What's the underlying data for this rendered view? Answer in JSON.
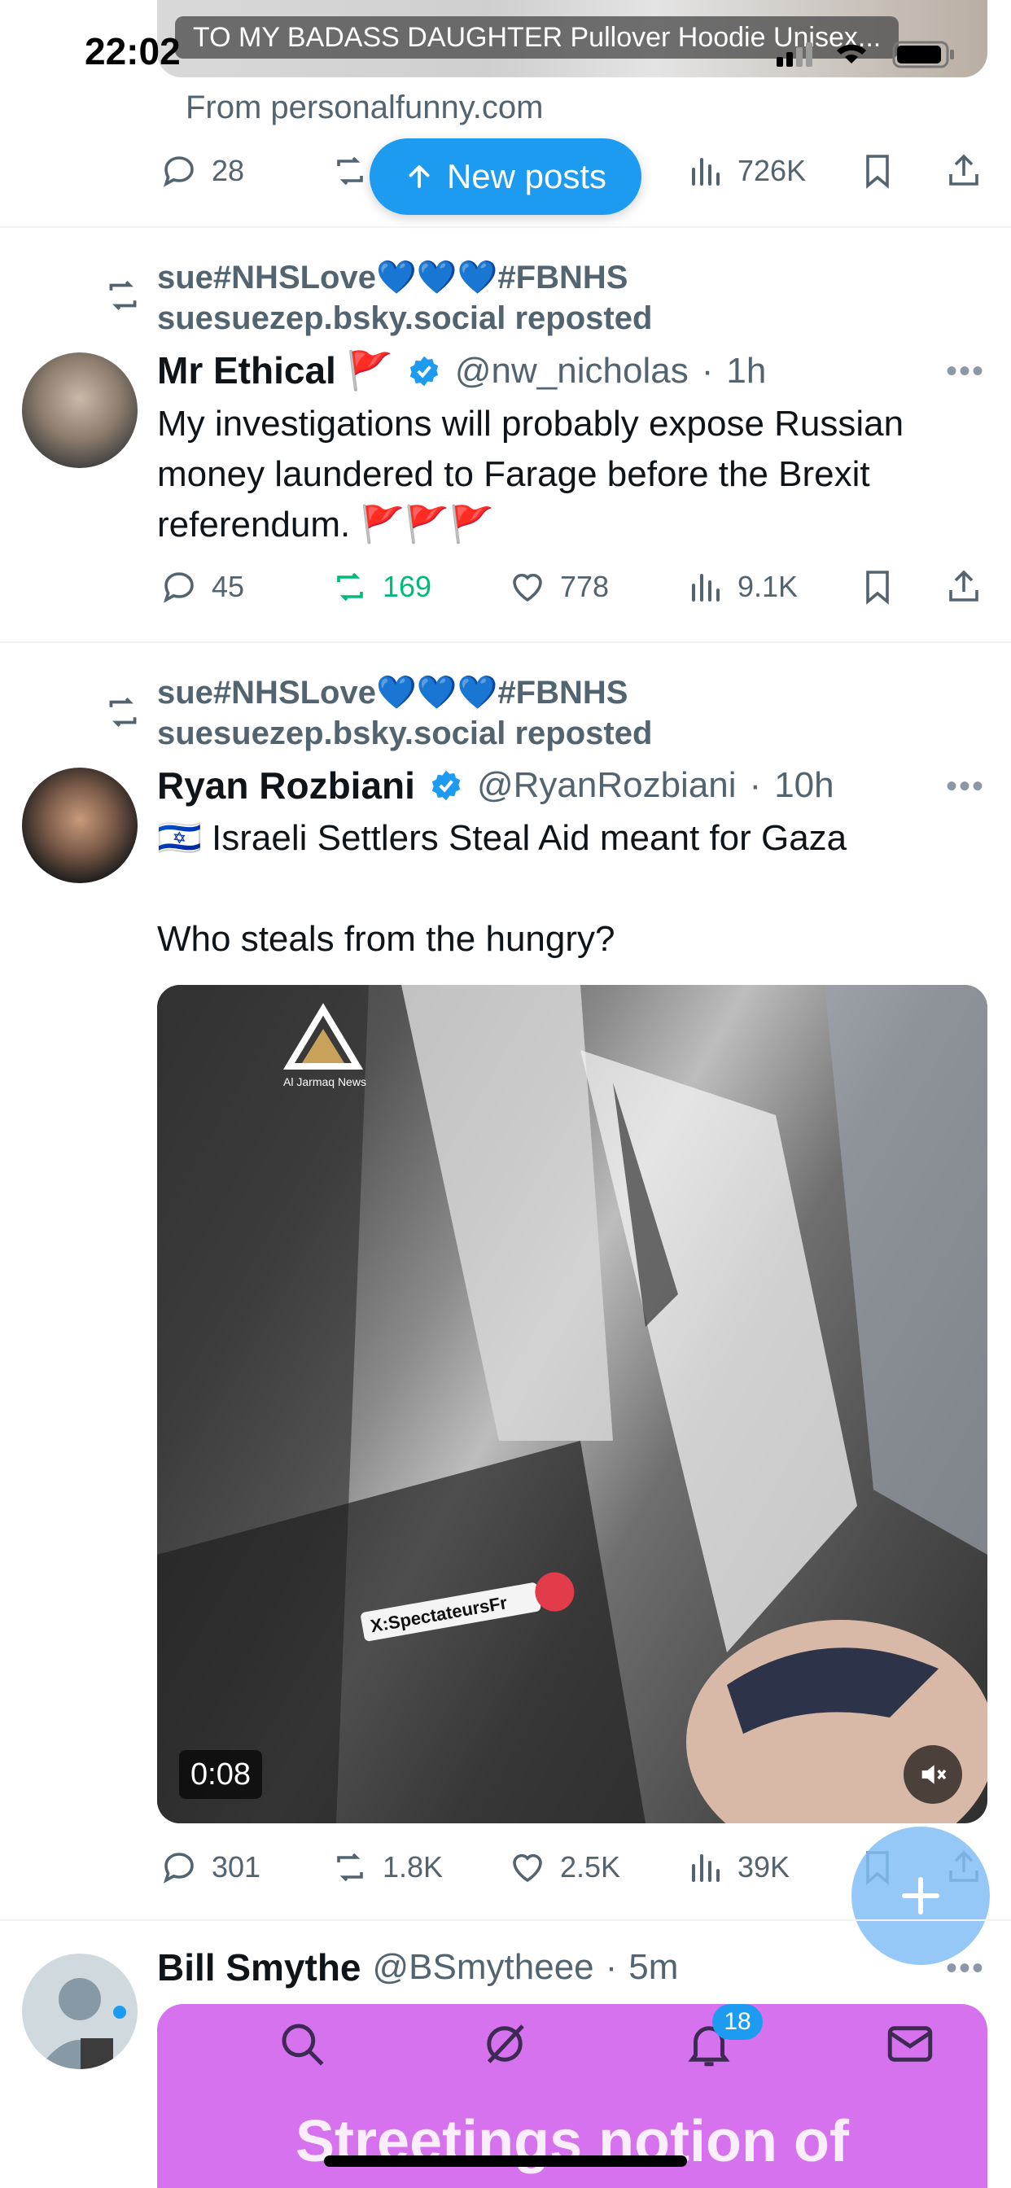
{
  "status_bar": {
    "time": "22:02"
  },
  "ad": {
    "caption": "TO MY BADASS DAUGHTER Pullover Hoodie Unisex...",
    "from": "From personalfunny.com",
    "metrics": {
      "replies": "28",
      "views": "726K"
    }
  },
  "new_posts_label": "New posts",
  "posts": [
    {
      "repost_by": "sue#NHSLove💙💙💙#FBNHS",
      "repost_sub": "suesuezep.bsky.social reposted",
      "author": "Mr Ethical 🚩",
      "handle": "@nw_nicholas",
      "time": "1h",
      "text": "My investigations will probably expose Russian money laundered to Farage before the Brexit referendum. 🚩🚩🚩",
      "metrics": {
        "replies": "45",
        "reposts": "169",
        "likes": "778",
        "views": "9.1K"
      }
    },
    {
      "repost_by": "sue#NHSLove💙💙💙#FBNHS",
      "repost_sub": "suesuezep.bsky.social reposted",
      "author": "Ryan Rozbiani",
      "handle": "@RyanRozbiani",
      "time": "10h",
      "text_line1": "🇮🇱 Israeli Settlers Steal Aid meant for Gaza",
      "text_line2": "Who steals from the hungry?",
      "video": {
        "duration": "0:08",
        "watermark_logo": "Al Jarmaq News",
        "watermark_tag": "X:SpectateursFr"
      },
      "metrics": {
        "replies": "301",
        "reposts": "1.8K",
        "likes": "2.5K",
        "views": "39K"
      }
    },
    {
      "author": "Bill Smythe",
      "handle": "@BSmytheee",
      "time": "5m"
    }
  ],
  "bottom_nav": {
    "notifications_badge": "18",
    "banner_text": "Streetings notion of"
  },
  "colors": {
    "accent": "#1d9bf0",
    "repost_green": "#00ba7c",
    "banner": "#d772ee"
  }
}
